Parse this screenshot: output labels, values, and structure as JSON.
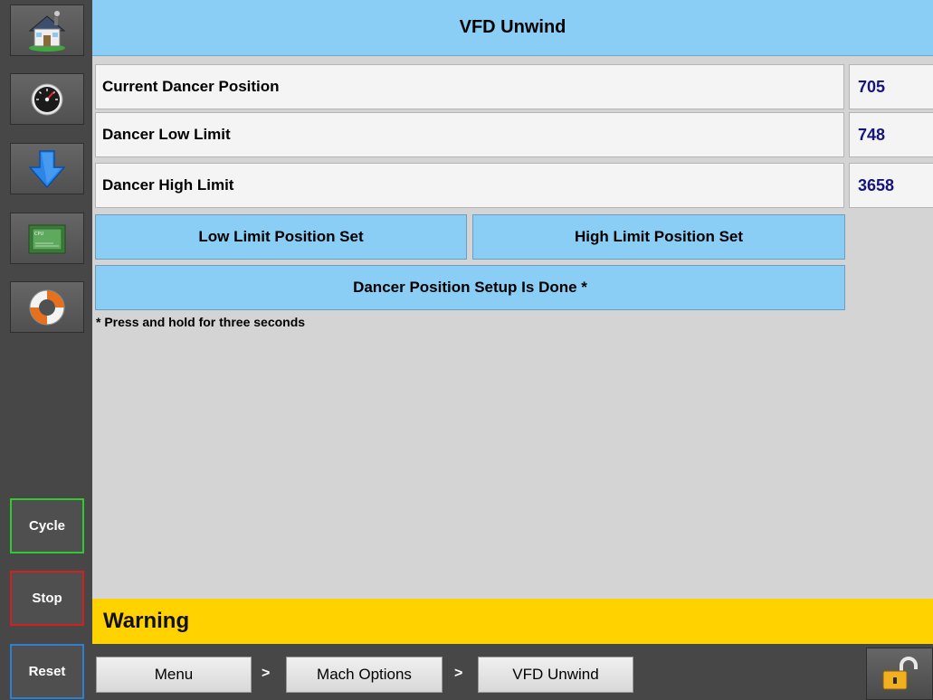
{
  "header": {
    "title": "VFD Unwind"
  },
  "rows": [
    {
      "label": "Current Dancer Position",
      "value": "705"
    },
    {
      "label": "Dancer Low Limit",
      "value": "748"
    },
    {
      "label": "Dancer High Limit",
      "value": "3658"
    }
  ],
  "buttons": {
    "low_limit": "Low Limit Position Set",
    "high_limit": "High Limit Position Set",
    "setup_done": "Dancer Position Setup Is Done *"
  },
  "note": "* Press and hold for three seconds",
  "warning": "Warning",
  "sidebar": {
    "icons": [
      "home-icon",
      "gauge-icon",
      "download-arrow-icon",
      "cpu-icon",
      "lifebuoy-icon"
    ],
    "cycle": "Cycle",
    "stop": "Stop",
    "reset": "Reset"
  },
  "breadcrumb": {
    "items": [
      "Menu",
      "Mach Options",
      "VFD Unwind"
    ],
    "separator": ">"
  },
  "colors": {
    "header_blue": "#8acdf5",
    "warning_yellow": "#ffd200",
    "value_text": "#14147a",
    "cycle_border": "#32c832",
    "stop_border": "#d02020",
    "reset_border": "#2f7fd0"
  }
}
